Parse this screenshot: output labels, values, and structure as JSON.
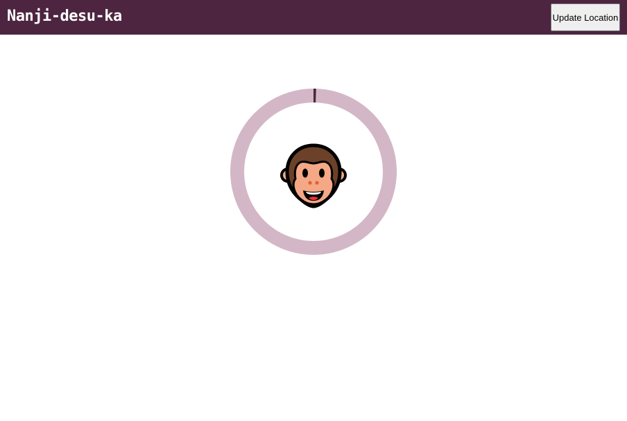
{
  "header": {
    "title": "Nanji-desu-ka",
    "update_button_label": "Update Location"
  },
  "progress": {
    "value": 0.005
  },
  "center_icon": "monkey-face-icon",
  "colors": {
    "header_bg": "#4d2540",
    "ring_track": "#d3b7c7",
    "ring_progress": "#4d2540",
    "button_bg": "#efefef"
  }
}
